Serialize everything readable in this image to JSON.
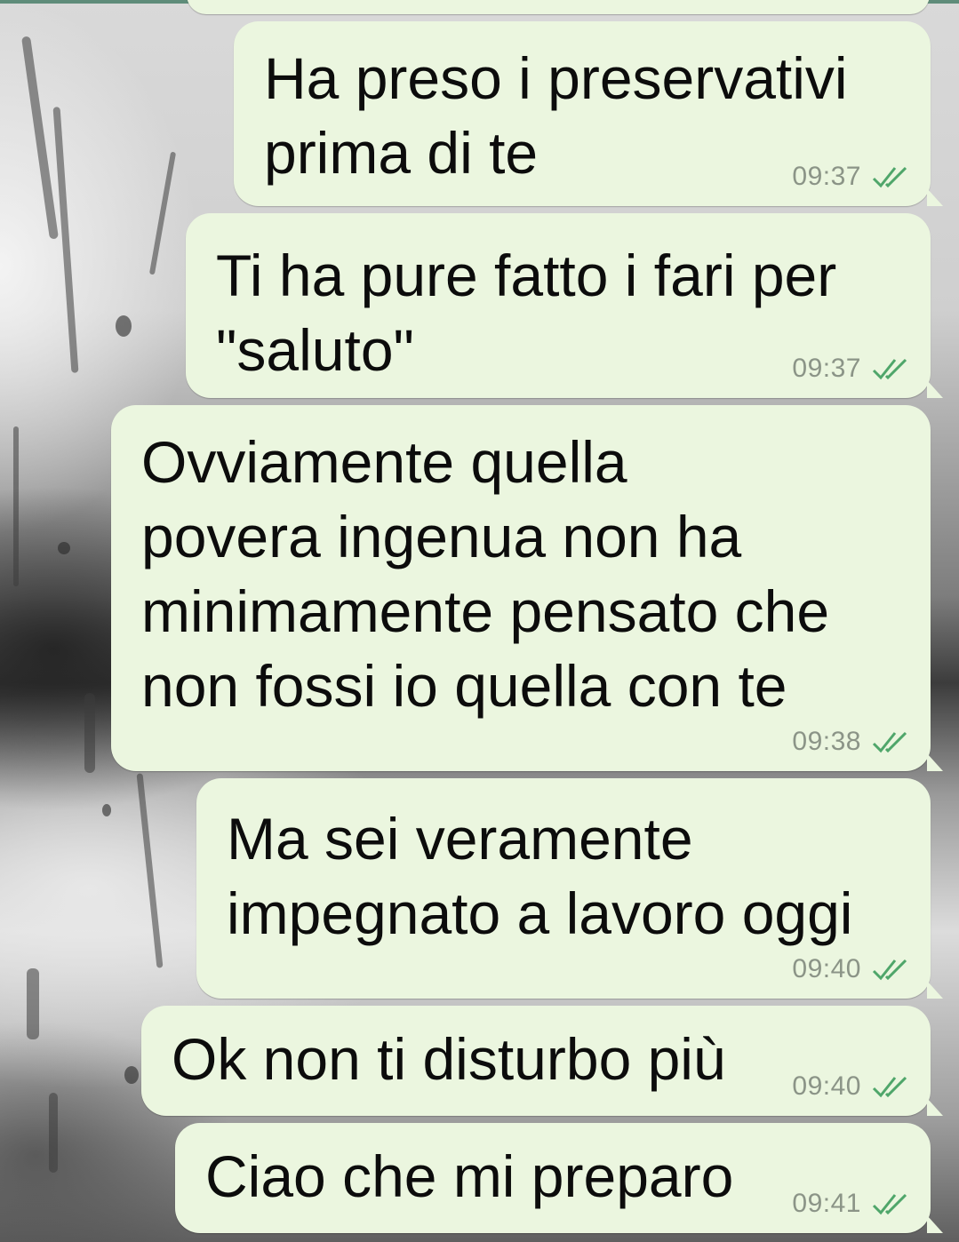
{
  "chat": {
    "wallpaper": "rainy-window-grayscale",
    "bubble_color": "#ebf6df",
    "tick_color": "#4fa66a",
    "messages": [
      {
        "text": "Ha preso i preservativi\nprima di te",
        "time": "09:37",
        "status": "read"
      },
      {
        "text": "Ti ha pure fatto i fari per\n\"saluto\"",
        "time": "09:37",
        "status": "read"
      },
      {
        "text": "Ovviamente quella\npovera ingenua non ha\nminimamente pensato che\nnon fossi io quella con te",
        "time": "09:38",
        "status": "read"
      },
      {
        "text": "Ma sei veramente\nimpegnato a lavoro oggi",
        "time": "09:40",
        "status": "read"
      },
      {
        "text": "Ok non ti disturbo più",
        "time": "09:40",
        "status": "read"
      },
      {
        "text": "Ciao che mi preparo",
        "time": "09:41",
        "status": "read"
      }
    ]
  }
}
